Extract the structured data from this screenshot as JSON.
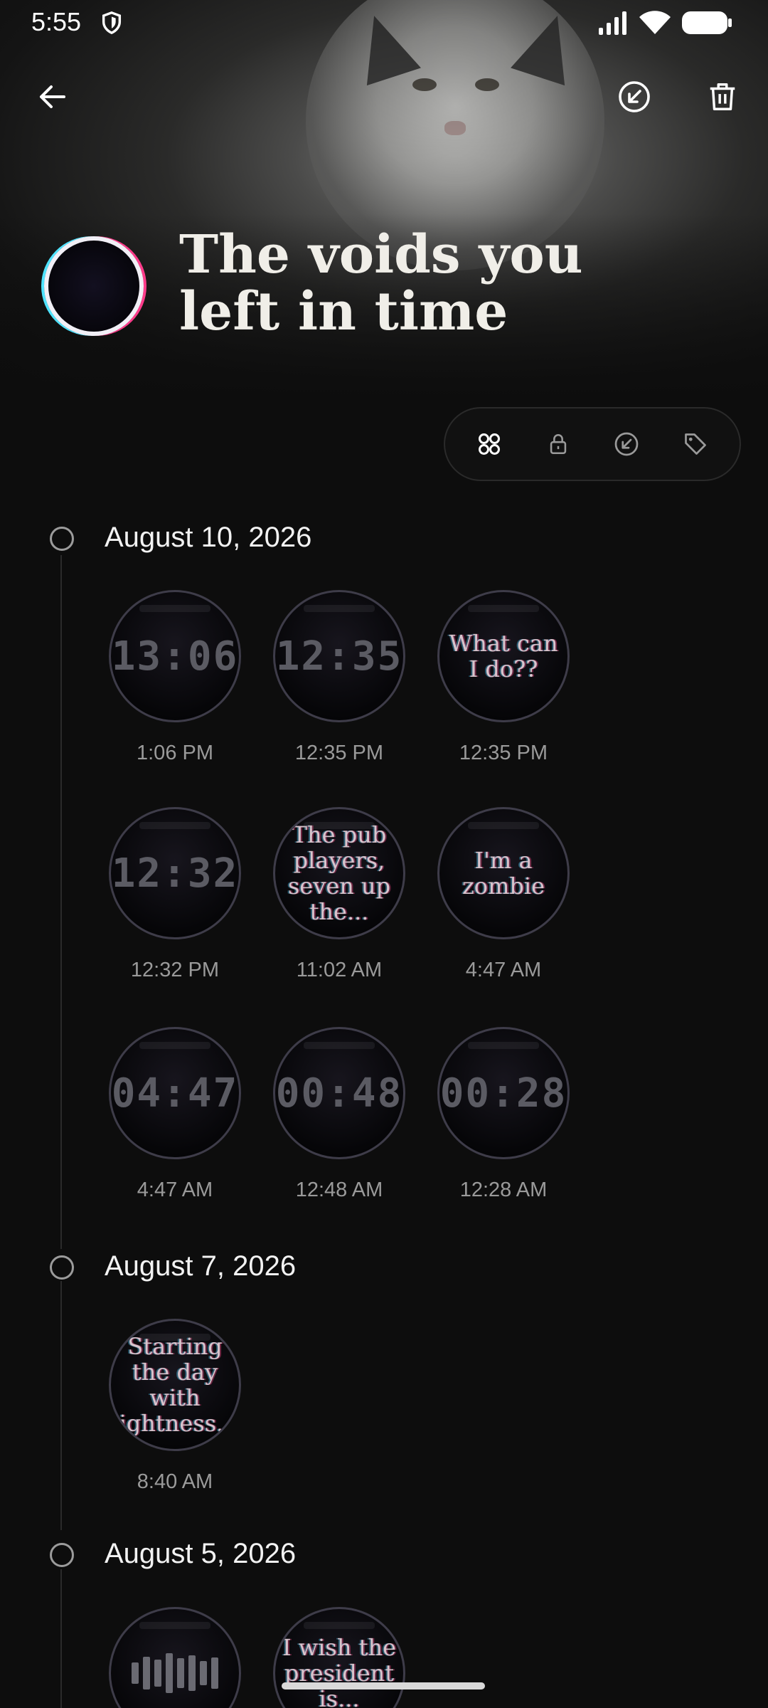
{
  "status_bar": {
    "time": "5:55"
  },
  "header": {
    "title": "The voids you left in time"
  },
  "filters": [
    {
      "name": "all",
      "icon": "grid-icon"
    },
    {
      "name": "locked",
      "icon": "lock-icon"
    },
    {
      "name": "sent",
      "icon": "arrow-circle-icon"
    },
    {
      "name": "tags",
      "icon": "tag-icon"
    }
  ],
  "groups": [
    {
      "date": "August 10, 2026",
      "entries": [
        {
          "kind": "digits",
          "display": "13:06",
          "time": "1:06 PM"
        },
        {
          "kind": "digits",
          "display": "12:35",
          "time": "12:35 PM"
        },
        {
          "kind": "note",
          "display": "What can I do??",
          "time": "12:35 PM"
        },
        {
          "kind": "digits",
          "display": "12:32",
          "time": "12:32 PM"
        },
        {
          "kind": "note",
          "display": "The pub players, seven up the...",
          "time": "11:02 AM"
        },
        {
          "kind": "note",
          "display": "I'm a zombie",
          "time": "4:47 AM"
        },
        {
          "kind": "digits",
          "display": "04:47",
          "time": "4:47 AM"
        },
        {
          "kind": "digits",
          "display": "00:48",
          "time": "12:48 AM"
        },
        {
          "kind": "digits",
          "display": "00:28",
          "time": "12:28 AM"
        }
      ]
    },
    {
      "date": "August 7, 2026",
      "entries": [
        {
          "kind": "note",
          "display": "Starting the day with lightness...",
          "time": "8:40 AM"
        }
      ]
    },
    {
      "date": "August 5, 2026",
      "entries": [
        {
          "kind": "wave",
          "display": "",
          "time": ""
        },
        {
          "kind": "note",
          "display": "I wish the president is...",
          "time": ""
        }
      ]
    }
  ]
}
